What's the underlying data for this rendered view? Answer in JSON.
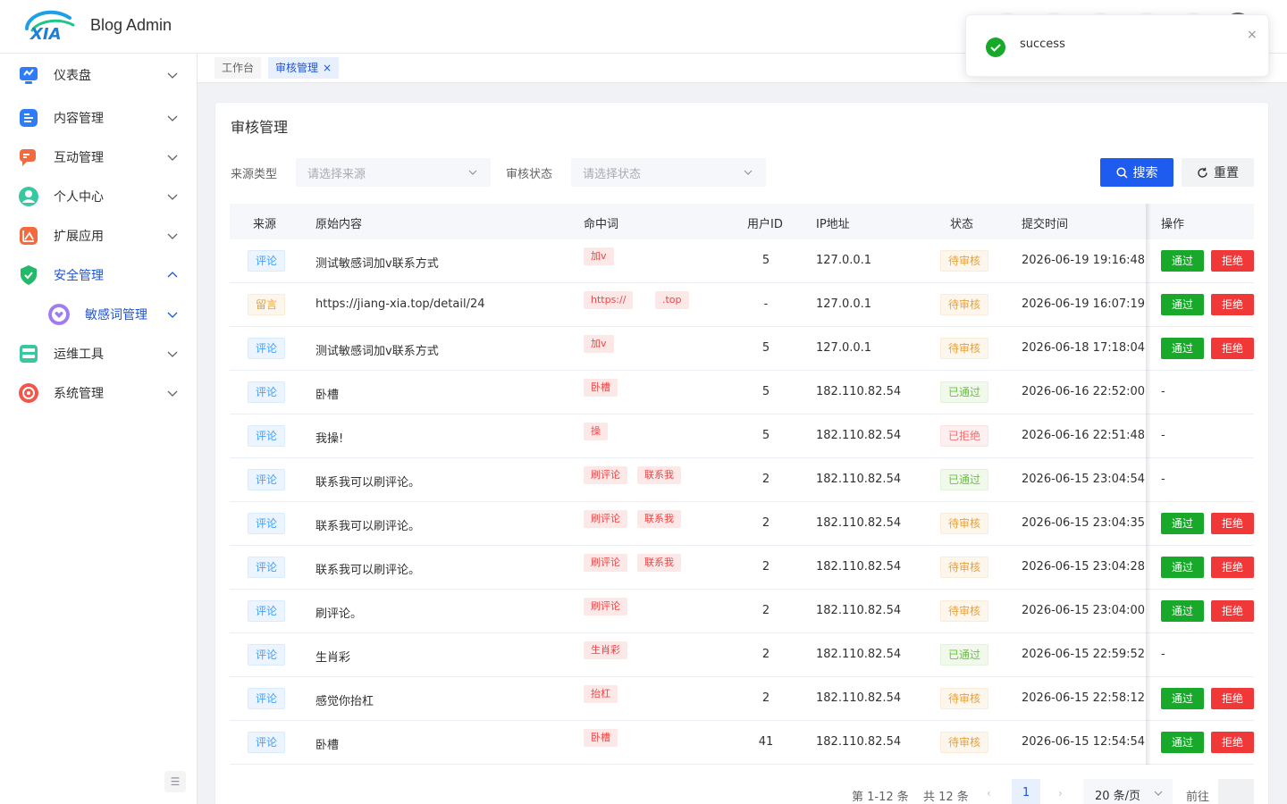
{
  "app": {
    "logo_text": "XIA",
    "brand": "Blog Admin"
  },
  "colors": {
    "primary": "#1e5cf0",
    "success": "#18a82a",
    "danger": "#f03838",
    "active_menu": "#1e54d6"
  },
  "sidebar": {
    "items": [
      {
        "label": "仪表盘",
        "icon": "dashboard-icon"
      },
      {
        "label": "内容管理",
        "icon": "content-icon"
      },
      {
        "label": "互动管理",
        "icon": "interaction-icon"
      },
      {
        "label": "个人中心",
        "icon": "user-icon"
      },
      {
        "label": "扩展应用",
        "icon": "extension-icon"
      },
      {
        "label": "安全管理",
        "icon": "shield-icon",
        "expanded": true
      },
      {
        "label": "敏感词管理",
        "icon": "heart-icon",
        "sub": true,
        "active": true
      },
      {
        "label": "运维工具",
        "icon": "ops-icon"
      },
      {
        "label": "系统管理",
        "icon": "settings-icon"
      }
    ],
    "collapse_glyph": "☰"
  },
  "tags": {
    "home": "工作台",
    "current": "审核管理",
    "close_glyph": "×"
  },
  "page": {
    "title": "审核管理",
    "filters": {
      "source_label": "来源类型",
      "source_placeholder": "请选择来源",
      "status_label": "审核状态",
      "status_placeholder": "请选择状态"
    },
    "search_button": "搜索",
    "reset_button": "重置"
  },
  "table": {
    "headers": {
      "source": "来源",
      "content": "原始内容",
      "keywords": "命中词",
      "user_id": "用户ID",
      "ip": "IP地址",
      "status": "状态",
      "time": "提交时间",
      "actions": "操作"
    },
    "approve_label": "通过",
    "reject_label": "拒绝",
    "rows": [
      {
        "source": "评论",
        "content": "测试敏感词加v联系方式",
        "keywords": [
          "加v"
        ],
        "user_id": "5",
        "ip": "127.0.0.1",
        "status": "待审核",
        "time": "2026-06-19 19:16:48",
        "actions": true
      },
      {
        "source": "留言",
        "content": "https://jiang-xia.top/detail/24",
        "keywords": [
          "https://",
          ".top"
        ],
        "user_id": "-",
        "ip": "127.0.0.1",
        "status": "待审核",
        "time": "2026-06-19 16:07:19",
        "actions": true
      },
      {
        "source": "评论",
        "content": "测试敏感词加v联系方式",
        "keywords": [
          "加v"
        ],
        "user_id": "5",
        "ip": "127.0.0.1",
        "status": "待审核",
        "time": "2026-06-18 17:18:04",
        "actions": true
      },
      {
        "source": "评论",
        "content": "卧槽",
        "keywords": [
          "卧槽"
        ],
        "user_id": "5",
        "ip": "182.110.82.54",
        "status": "已通过",
        "time": "2026-06-16 22:52:00",
        "actions": false,
        "dash": "-"
      },
      {
        "source": "评论",
        "content": "我操!",
        "keywords": [
          "操"
        ],
        "user_id": "5",
        "ip": "182.110.82.54",
        "status": "已拒绝",
        "time": "2026-06-16 22:51:48",
        "actions": false,
        "dash": "-"
      },
      {
        "source": "评论",
        "content": "联系我可以刷评论。",
        "keywords": [
          "刷评论",
          "联系我"
        ],
        "user_id": "2",
        "ip": "182.110.82.54",
        "status": "已通过",
        "time": "2026-06-15 23:04:54",
        "actions": false,
        "dash": "-"
      },
      {
        "source": "评论",
        "content": "联系我可以刷评论。",
        "keywords": [
          "刷评论",
          "联系我"
        ],
        "user_id": "2",
        "ip": "182.110.82.54",
        "status": "待审核",
        "time": "2026-06-15 23:04:35",
        "actions": true
      },
      {
        "source": "评论",
        "content": "联系我可以刷评论。",
        "keywords": [
          "刷评论",
          "联系我"
        ],
        "user_id": "2",
        "ip": "182.110.82.54",
        "status": "待审核",
        "time": "2026-06-15 23:04:28",
        "actions": true
      },
      {
        "source": "评论",
        "content": "刷评论。",
        "keywords": [
          "刷评论"
        ],
        "user_id": "2",
        "ip": "182.110.82.54",
        "status": "待审核",
        "time": "2026-06-15 23:04:00",
        "actions": true
      },
      {
        "source": "评论",
        "content": "生肖彩",
        "keywords": [
          "生肖彩"
        ],
        "user_id": "2",
        "ip": "182.110.82.54",
        "status": "已通过",
        "time": "2026-06-15 22:59:52",
        "actions": false,
        "dash": "-"
      },
      {
        "source": "评论",
        "content": "感觉你抬杠",
        "keywords": [
          "抬杠"
        ],
        "user_id": "2",
        "ip": "182.110.82.54",
        "status": "待审核",
        "time": "2026-06-15 22:58:12",
        "actions": true
      },
      {
        "source": "评论",
        "content": "卧槽",
        "keywords": [
          "卧槽"
        ],
        "user_id": "41",
        "ip": "182.110.82.54",
        "status": "待审核",
        "time": "2026-06-15 12:54:54",
        "actions": true
      }
    ]
  },
  "pagination": {
    "range": "第 1-12 条",
    "total": "共 12 条",
    "prev_glyph": "‹",
    "next_glyph": "›",
    "current_page": "1",
    "page_size": "20 条/页",
    "jump_label": "前往"
  },
  "notification": {
    "message": "success",
    "close_glyph": "×"
  }
}
